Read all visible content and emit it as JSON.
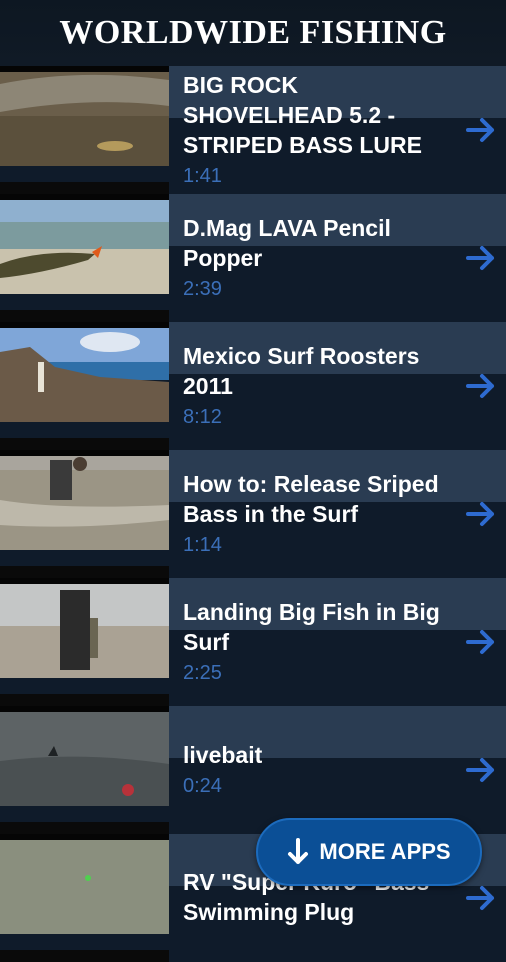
{
  "header": {
    "title": "WORLDWIDE FISHING"
  },
  "videos": [
    {
      "title": "BIG ROCK SHOVELHEAD 5.2 - STRIPED BASS LURE",
      "duration": "1:41"
    },
    {
      "title": "D.Mag LAVA Pencil Popper",
      "duration": "2:39"
    },
    {
      "title": "Mexico Surf Roosters 2011",
      "duration": "8:12"
    },
    {
      "title": "How to:  Release Sriped Bass in the Surf",
      "duration": "1:14"
    },
    {
      "title": "Landing Big Fish in Big Surf",
      "duration": "2:25"
    },
    {
      "title": "livebait",
      "duration": "0:24"
    },
    {
      "title": "RV \"Super Kuro\" Bass Swimming Plug",
      "duration": ""
    }
  ],
  "fab": {
    "label": "MORE APPS",
    "icon": "arrow-down-icon"
  },
  "colors": {
    "accent": "#3b6fb8",
    "fab": "#0b4f96",
    "header": "#0d1722"
  }
}
